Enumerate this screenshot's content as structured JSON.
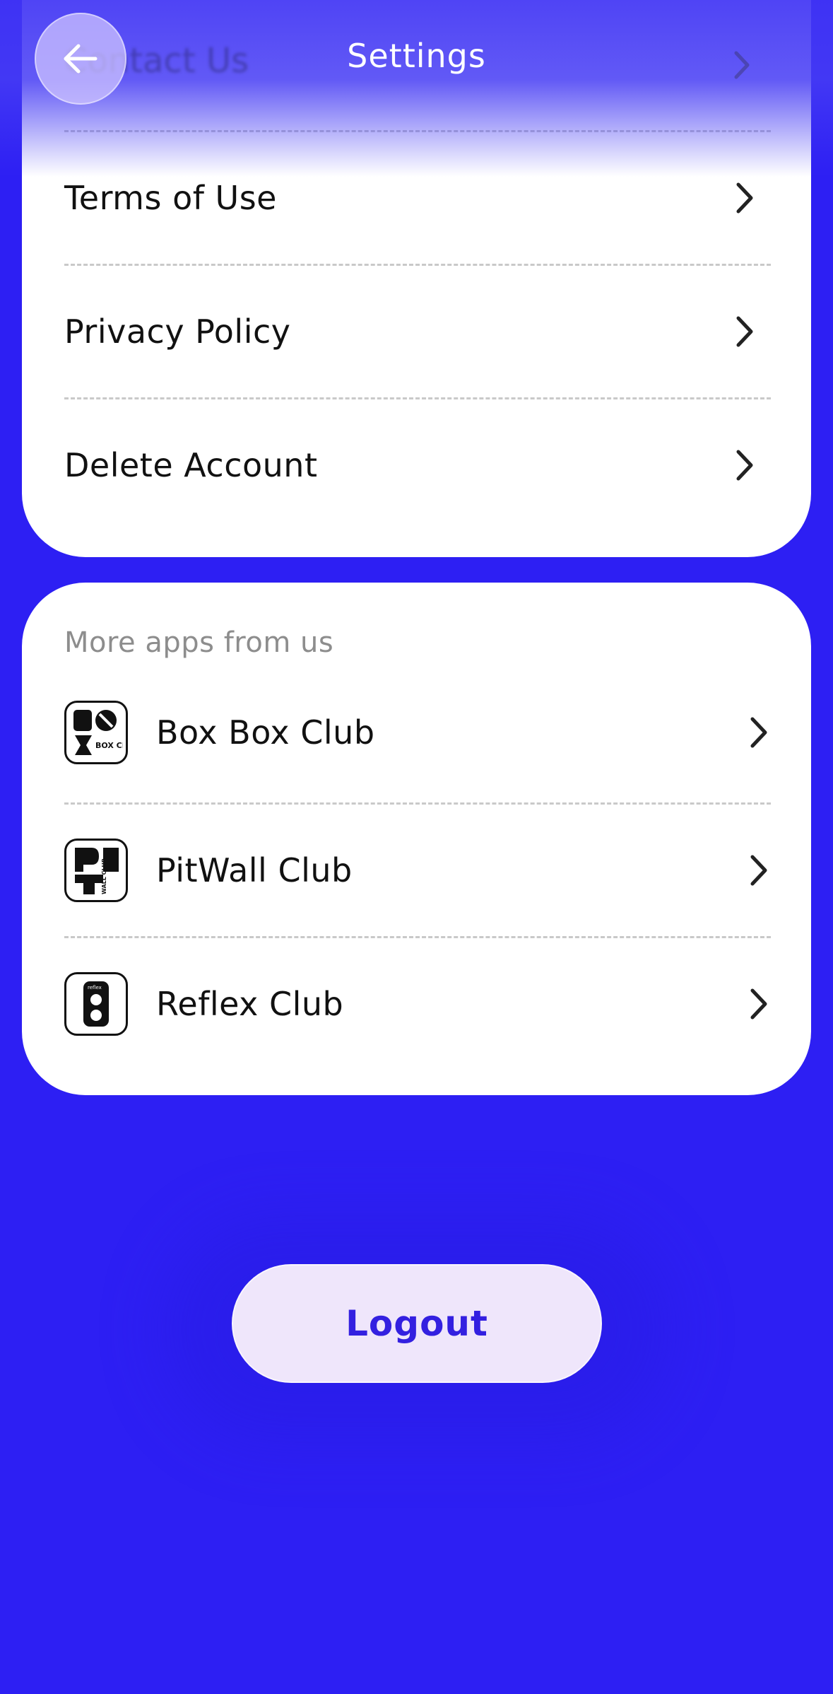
{
  "header": {
    "title": "Settings",
    "ghost_row_label": "Contact Us"
  },
  "settings": {
    "items": [
      {
        "label": "Terms of Use"
      },
      {
        "label": "Privacy Policy"
      },
      {
        "label": "Delete Account"
      }
    ]
  },
  "more_apps": {
    "caption": "More apps from us",
    "apps": [
      {
        "label": "Box Box Club",
        "icon": "box-box-club-logo",
        "logo_text": "BOX CLUB"
      },
      {
        "label": "PitWall Club",
        "icon": "pitwall-club-logo",
        "logo_text": "WALL CLUB"
      },
      {
        "label": "Reflex Club",
        "icon": "reflex-club-logo",
        "logo_text": "reflex"
      }
    ]
  },
  "logout": {
    "label": "Logout"
  },
  "colors": {
    "background": "#2d1ff3",
    "card": "#ffffff",
    "logout_bg": "#efe6fb",
    "logout_text": "#3320e0",
    "muted_text": "#8d8d8d"
  }
}
